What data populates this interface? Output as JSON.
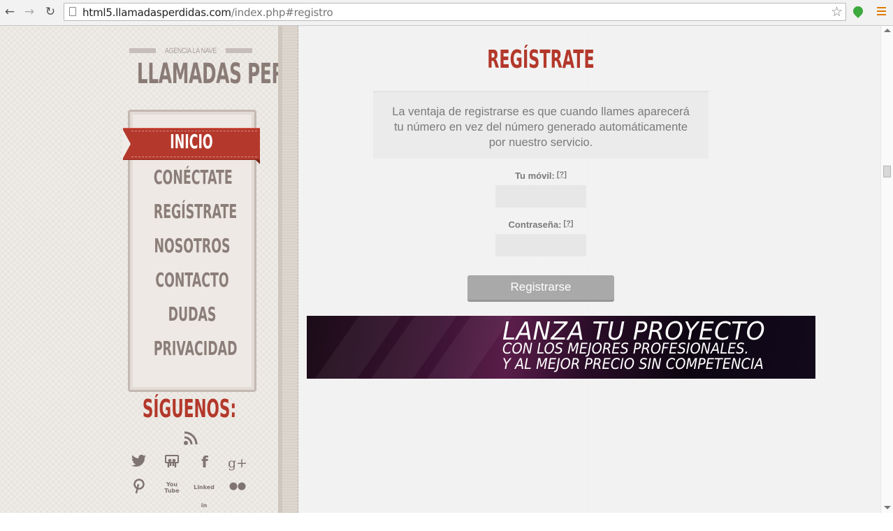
{
  "browser": {
    "url_host": "html5.llamadasperdidas.com",
    "url_path": "/index.php#registro"
  },
  "sidebar": {
    "agency": "AGENCIA LA NAVE",
    "logo": "LLAMADAS PERDIDAS",
    "menu": [
      {
        "label": "INICIO",
        "active": true
      },
      {
        "label": "CONÉCTATE"
      },
      {
        "label": "REGÍSTRATE"
      },
      {
        "label": "NOSOTROS"
      },
      {
        "label": "CONTACTO"
      },
      {
        "label": "DUDAS"
      },
      {
        "label": "PRIVACIDAD"
      }
    ],
    "follow_title": "SÍGUENOS:",
    "social": {
      "rss": "rss-icon",
      "twitter": "twitter-icon",
      "slideshare": "slideshare-icon",
      "facebook": "facebook-icon",
      "googleplus": "g+",
      "pinterest": "pinterest-icon",
      "youtube": "You Tube",
      "linkedin": "Linked in",
      "flickr": "flickr-icon"
    }
  },
  "main": {
    "title": "REGÍSTRATE",
    "info": "La ventaja de registrarse es que cuando llames aparecerá tu número en vez del número generado automáticamente por nuestro servicio.",
    "phone_label": "Tu móvil:",
    "password_label": "Contraseña:",
    "help_mark": "[?]",
    "phone_value": "",
    "password_value": "",
    "submit_label": "Registrarse",
    "banner": {
      "line1": "LANZA TU PROYECTO",
      "line2": "CON LOS MEJORES PROFESIONALES.",
      "line3": "Y AL MEJOR PRECIO SIN COMPETENCIA"
    }
  },
  "colors": {
    "accent_red": "#b3382b",
    "menu_text": "#8b7d78",
    "button_gray": "#a9a9a9"
  }
}
